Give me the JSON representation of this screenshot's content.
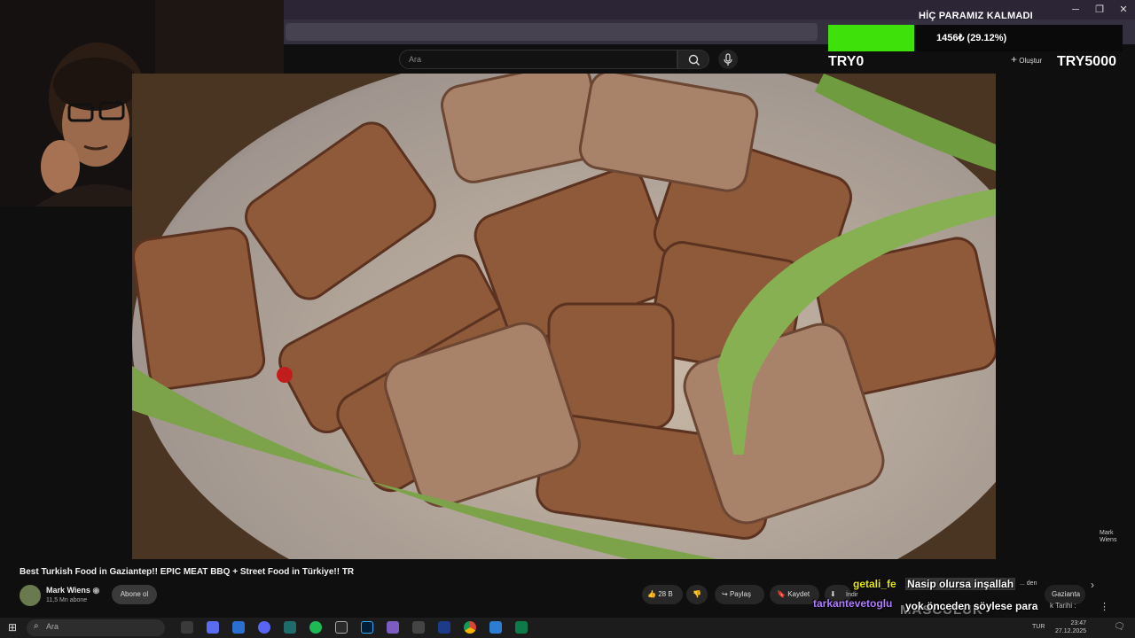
{
  "colors": {
    "goal_fill": "#3ee10a",
    "chat_user_1": "#e6e600",
    "chat_user_2": "#b07cff",
    "chat_text": "#ffffff"
  },
  "window": {
    "minimize_icon": "minimize-icon",
    "restore_icon": "restore-icon",
    "close_icon": "close-icon"
  },
  "youtube": {
    "search_placeholder": "Ara",
    "create_label": "Oluştur",
    "video_title": "Best Turkish Food in Gaziantep!! EPIC MEAT BBQ + Street Food in Türkiye!! TR",
    "channel_name": "Mark Wiens",
    "subscribers": "11,5 Mn abone",
    "subscribe_label": "Abone ol",
    "like_count": "28 B",
    "share_label": "Paylaş",
    "save_label": "Kaydet",
    "download_label": "İndir",
    "thanks_label": "... den",
    "chip_label": "Gazianta",
    "watermark": "Mark Wiens",
    "side_text": "k Tarihi :"
  },
  "donation_goal": {
    "title": "HİÇ PARAMIZ KALMADI",
    "amount_text": "1456₺ (29.12%)",
    "progress_fraction": 0.2912,
    "min_label": "TRY0",
    "max_label": "TRY5000"
  },
  "chat": [
    {
      "user": "getali_fe",
      "message": "Nasip olursa inşallah"
    },
    {
      "user": "tarkantevetoglu",
      "message": "yok önceden söylese para harcamazdım"
    }
  ],
  "overlay_brand": "MASCULUK",
  "taskbar": {
    "search_placeholder": "Ara",
    "time": "23:47",
    "date": "27.12.2025",
    "lang": "TUR"
  }
}
